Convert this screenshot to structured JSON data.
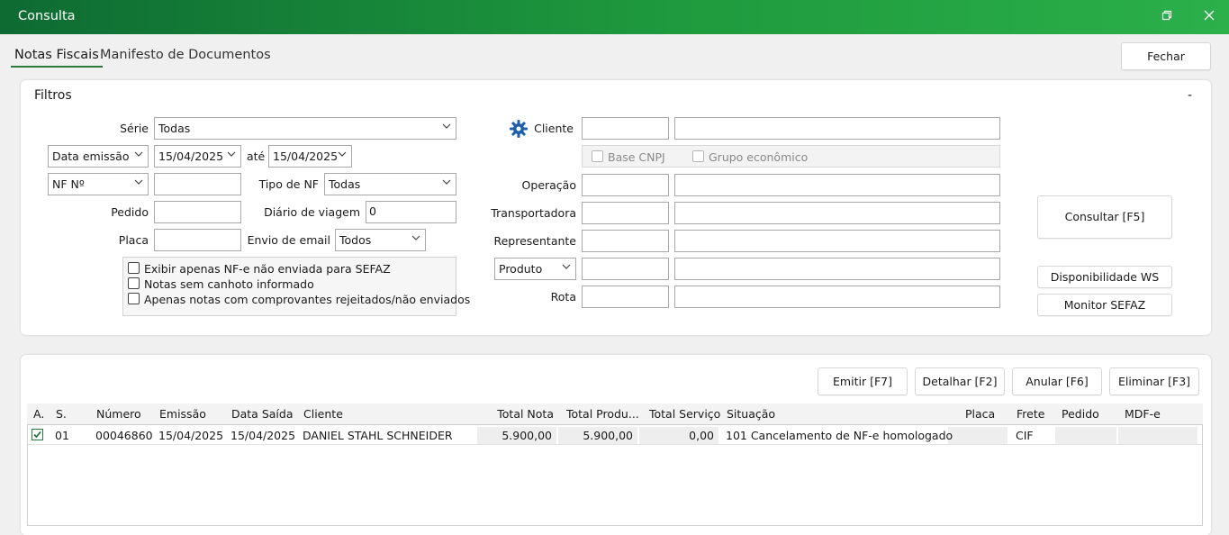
{
  "window": {
    "title": "Consulta"
  },
  "tabs": [
    {
      "label": "Notas Fiscais"
    },
    {
      "label": "Manifesto de Documentos"
    }
  ],
  "close_button": "Fechar",
  "filters": {
    "title": "Filtros",
    "collapse": "-",
    "serie": {
      "label": "Série",
      "value": "Todas"
    },
    "date_type": {
      "value": "Data emissão"
    },
    "date_from": "15/04/2025",
    "date_to_label": "até",
    "date_to": "15/04/2025",
    "nf_type": {
      "value": "NF Nº"
    },
    "nf_number": "",
    "tipo_nf": {
      "label": "Tipo de NF",
      "value": "Todas"
    },
    "pedido": {
      "label": "Pedido",
      "value": ""
    },
    "diario": {
      "label": "Diário de viagem",
      "value": "0"
    },
    "placa": {
      "label": "Placa",
      "value": ""
    },
    "envio_email": {
      "label": "Envio de email",
      "value": "Todos"
    },
    "checks": [
      {
        "label": "Exibir apenas NF-e não enviada para SEFAZ",
        "checked": false
      },
      {
        "label": "Notas sem canhoto informado",
        "checked": false
      },
      {
        "label": "Apenas notas com comprovantes rejeitados/não enviados",
        "checked": false
      }
    ],
    "cliente": {
      "label": "Cliente",
      "code": "",
      "name": ""
    },
    "base_cnpj": "Base CNPJ",
    "grupo_economico": "Grupo econômico",
    "operacao": {
      "label": "Operação"
    },
    "transportadora": {
      "label": "Transportadora"
    },
    "representante": {
      "label": "Representante"
    },
    "produto": {
      "value": "Produto"
    },
    "rota": {
      "label": "Rota"
    },
    "consultar": "Consultar [F5]",
    "disponibilidade": "Disponibilidade WS",
    "monitor": "Monitor SEFAZ"
  },
  "actions": {
    "emitir": "Emitir [F7]",
    "detalhar": "Detalhar [F2]",
    "anular": "Anular [F6]",
    "eliminar": "Eliminar [F3]"
  },
  "table": {
    "columns": [
      "A.",
      "S.",
      "Número",
      "Emissão",
      "Data Saída",
      "Cliente",
      "Total Nota",
      "Total Produ...",
      "Total Serviço",
      "Situação",
      "Placa",
      "Frete",
      "Pedido",
      "MDF-e"
    ],
    "rows": [
      {
        "checked": true,
        "serie": "01",
        "numero": "00046860",
        "emissao": "15/04/2025",
        "saida": "15/04/2025",
        "cliente": "DANIEL STAHL SCHNEIDER",
        "total_nota": "5.900,00",
        "total_produtos": "5.900,00",
        "total_servico": "0,00",
        "situacao": "101 Cancelamento de NF-e homologado",
        "placa": "",
        "frete": "CIF",
        "pedido": "",
        "mdfe": ""
      }
    ]
  },
  "colors": {
    "titlebar_start": "#0e6b33",
    "titlebar_end": "#2bb04a",
    "accent": "#2b7a3d",
    "gear_icon": "#1f5fa8"
  }
}
